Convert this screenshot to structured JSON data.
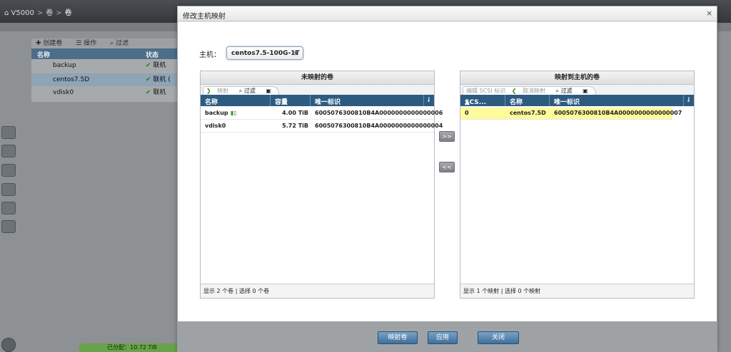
{
  "background": {
    "breadcrumb": [
      "V5000",
      "卷",
      "卷"
    ],
    "toolbar": [
      "创建卷",
      "操作",
      "过滤"
    ],
    "table_headers": [
      "名称",
      "状态"
    ],
    "rows": [
      {
        "name": "backup",
        "status": "联机"
      },
      {
        "name": "centos7.5D",
        "status": "联机 ("
      },
      {
        "name": "vdisk0",
        "status": "联机"
      }
    ],
    "bottom_status": "已分配：10.72 TiB"
  },
  "dialog": {
    "title": "修改主机映射",
    "close_icon": "×",
    "host_label": "主机：",
    "host_value": "centos7.5-100G-1T",
    "left_panel": {
      "title": "未映射的卷",
      "tools": [
        "映射",
        "过滤"
      ],
      "headers": [
        "名称",
        "容量",
        "唯一标识"
      ],
      "rows": [
        {
          "name": "backup",
          "capacity": "4.00 TiB",
          "uid": "6005076300810B4A0000000000000006"
        },
        {
          "name": "vdisk0",
          "capacity": "5.72 TiB",
          "uid": "6005076300810B4A0000000000000004"
        }
      ],
      "footer": "显示 2 个卷 | 选择 0 个卷"
    },
    "right_panel": {
      "title": "映射到主机的卷",
      "tools": [
        "编辑 SCSI 标识",
        "取消映射",
        "过滤"
      ],
      "headers": [
        "SCS...",
        "名称",
        "唯一标识"
      ],
      "rows": [
        {
          "scsi": "0",
          "name": "centos7.5D",
          "uid": "6005076300810B4A0000000000000007"
        }
      ],
      "footer": "显示 1 个映射 | 选择 0 个映射"
    },
    "move_right": ">>",
    "move_left": "<<",
    "buttons": {
      "map": "映射卷",
      "apply": "应用",
      "close": "关闭"
    }
  },
  "colors": {
    "header_blue": "#2d5b80",
    "selected_row": "#fdfb9a",
    "button_blue": "#3f6f9c",
    "online_green": "#2f7a12"
  }
}
